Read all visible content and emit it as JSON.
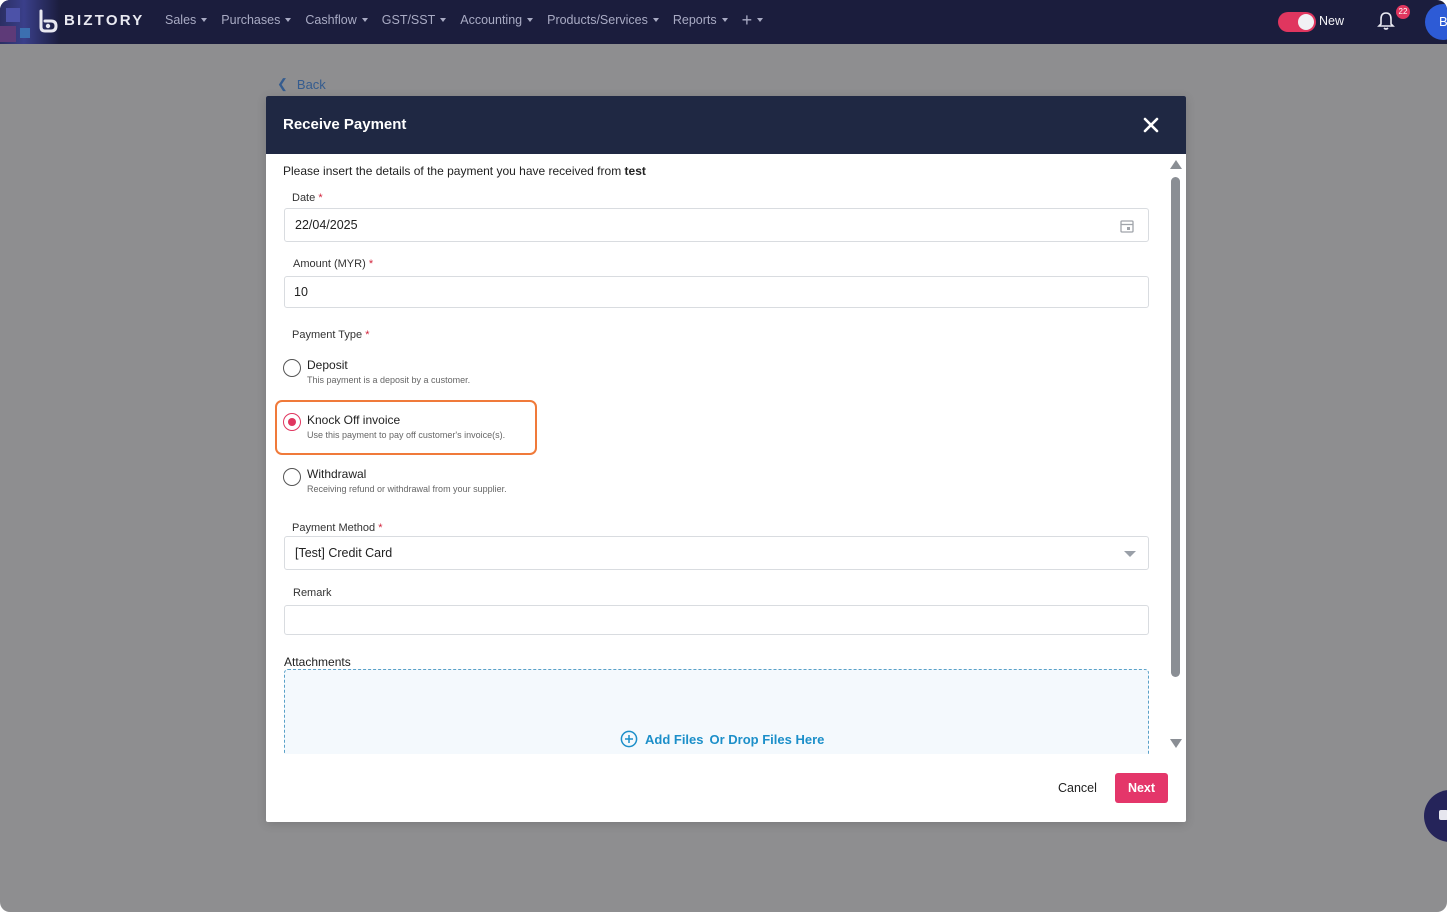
{
  "nav": {
    "brand": "BIZTORY",
    "menu": [
      "Sales",
      "Purchases",
      "Cashflow",
      "GST/SST",
      "Accounting",
      "Products/Services",
      "Reports"
    ],
    "toggle_label": "New",
    "notification_count": "22",
    "avatar_initial": "B",
    "colors": {
      "bar": "#1b1d3d",
      "accent": "#e0365f"
    }
  },
  "back_label": "Back",
  "modal": {
    "title": "Receive Payment",
    "intro_text": "Please insert the details of the payment you have received from ",
    "intro_customer": "test",
    "date": {
      "label": "Date",
      "value": "22/04/2025"
    },
    "amount": {
      "label": "Amount (MYR)",
      "value": "10"
    },
    "payment_type": {
      "label": "Payment Type",
      "selected": "Knock Off invoice",
      "options": [
        {
          "title": "Deposit",
          "desc": "This payment is a deposit by a customer."
        },
        {
          "title": "Knock Off invoice",
          "desc": "Use this payment to pay off customer's invoice(s)."
        },
        {
          "title": "Withdrawal",
          "desc": "Receiving refund or withdrawal from your supplier."
        }
      ]
    },
    "payment_method": {
      "label": "Payment Method",
      "value": "[Test] Credit Card"
    },
    "remark": {
      "label": "Remark",
      "value": ""
    },
    "attachments": {
      "label": "Attachments",
      "add_text": "Add Files",
      "drop_text": "Or Drop Files Here"
    },
    "required_mark": "*",
    "footer": {
      "cancel_label": "Cancel",
      "next_label": "Next"
    },
    "colors": {
      "header": "#1f2843",
      "primary": "#e4366a",
      "highlight": "#f07a3a",
      "link": "#1c8fc9"
    }
  }
}
